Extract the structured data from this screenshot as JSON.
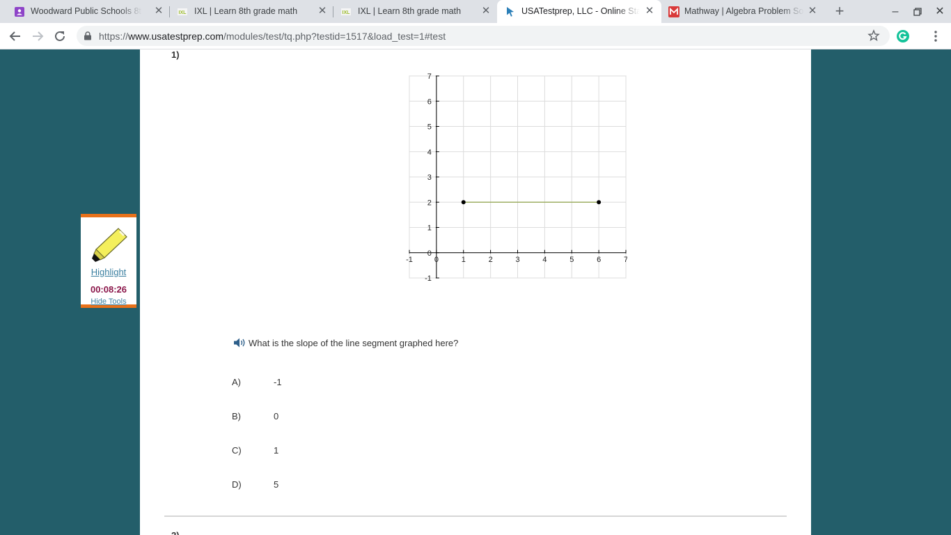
{
  "tabs": [
    {
      "title": "Woodward Public Schools 8th G",
      "active": false
    },
    {
      "title": "IXL | Learn 8th grade math",
      "active": false
    },
    {
      "title": "IXL | Learn 8th grade math",
      "active": false
    },
    {
      "title": "USATestprep, LLC - Online State",
      "active": true
    },
    {
      "title": "Mathway | Algebra Problem Sol",
      "active": false
    }
  ],
  "toolbar": {
    "url_prefix": "https://",
    "url_host": "www.usatestprep.com",
    "url_path": "/modules/test/tq.php?testid=1517&load_test=1#test"
  },
  "tools": {
    "highlight_label": "Highlight",
    "timer": "00:08:26",
    "hide_label": "Hide Tools"
  },
  "question": {
    "number": "1)",
    "next_number": "2)",
    "text": "What is the slope of the line segment graphed here?",
    "choices": [
      {
        "letter": "A)",
        "value": "-1"
      },
      {
        "letter": "B)",
        "value": "0"
      },
      {
        "letter": "C)",
        "value": "1"
      },
      {
        "letter": "D)",
        "value": "5"
      }
    ]
  },
  "chart_data": {
    "type": "line",
    "title": "",
    "xlabel": "",
    "ylabel": "",
    "xlim": [
      -1,
      7
    ],
    "ylim": [
      -1,
      7
    ],
    "x_ticks": [
      "-1",
      "0",
      "1",
      "2",
      "3",
      "4",
      "5",
      "6",
      "7"
    ],
    "y_ticks": [
      "-1",
      "0",
      "1",
      "2",
      "3",
      "4",
      "5",
      "6",
      "7"
    ],
    "grid": true,
    "series": [
      {
        "points": [
          [
            1,
            2
          ],
          [
            6,
            2
          ]
        ],
        "color": "#8fa34a",
        "endpoint_color": "#000000"
      }
    ]
  },
  "colors": {
    "page_background": "#235e6a",
    "tools_accent": "#e8711a",
    "timer_color": "#8a1549",
    "link_color": "#3a7fa0"
  }
}
